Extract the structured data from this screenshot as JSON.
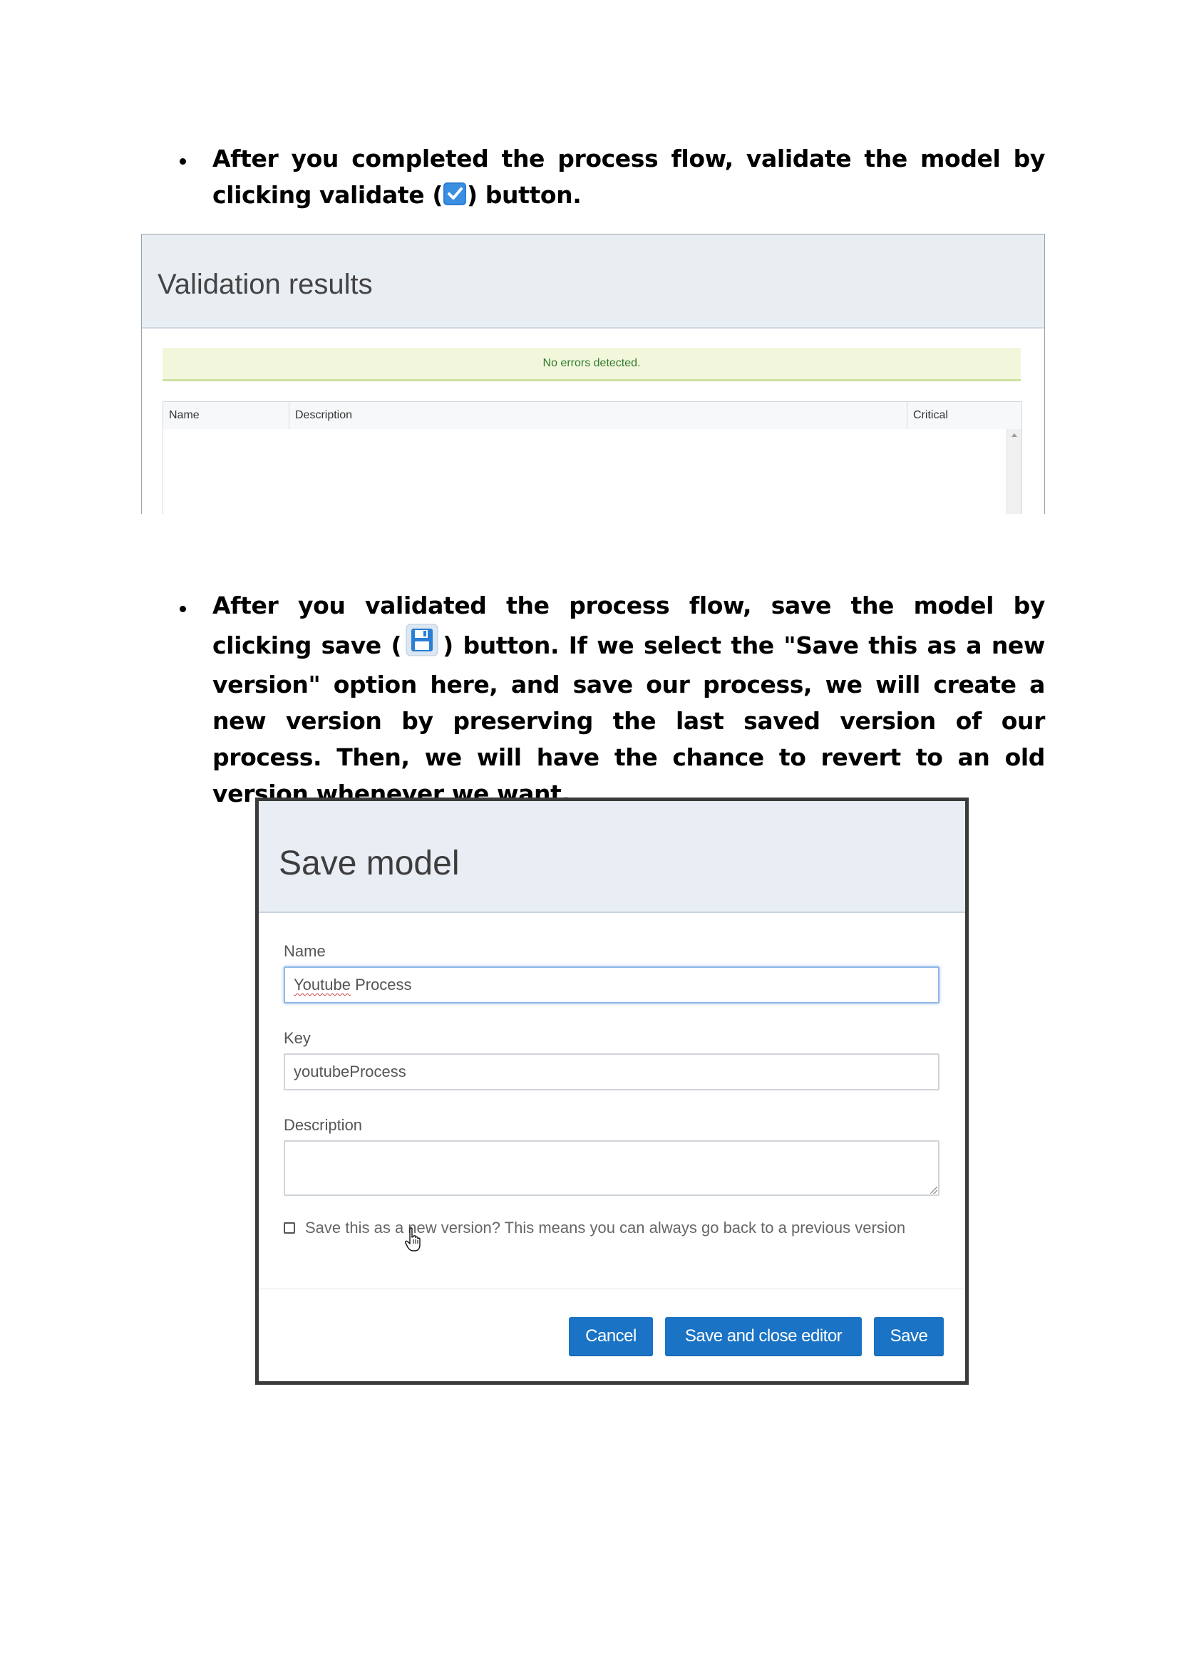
{
  "section1": {
    "text_before_icon": "After you completed the process flow, validate the model by clicking validate (",
    "text_after_icon": ") button.",
    "icon": "checkmark-icon",
    "icon_color": "#2a7fd4"
  },
  "validation_panel": {
    "title": "Validation results",
    "status": "No errors detected.",
    "status_color": "#2f7a2f",
    "columns": [
      "Name",
      "Description",
      "Critical"
    ]
  },
  "section2": {
    "text_before_icon": "After you validated the process flow, save the model by clicking save (",
    "text_after_icon": ") button. If we select the \"Save this as a new version\" option here, and save our process, we will create a new version by preserving the last saved version of our process. Then, we will have the chance to revert to an old version whenever we want.",
    "icon": "floppy-disk-icon",
    "icon_color": "#2a7fd4"
  },
  "save_dialog": {
    "title": "Save model",
    "name_label": "Name",
    "name_value_part1": "Youtube",
    "name_value_part2": " Process",
    "key_label": "Key",
    "key_value": "youtubeProcess",
    "description_label": "Description",
    "description_value": "",
    "checkbox_label": "Save this as a new version? This means you can always go back to a previous version",
    "checkbox_checked": false,
    "buttons": {
      "cancel": "Cancel",
      "save_close": "Save and close editor",
      "save": "Save"
    },
    "button_color": "#1a73c4"
  }
}
